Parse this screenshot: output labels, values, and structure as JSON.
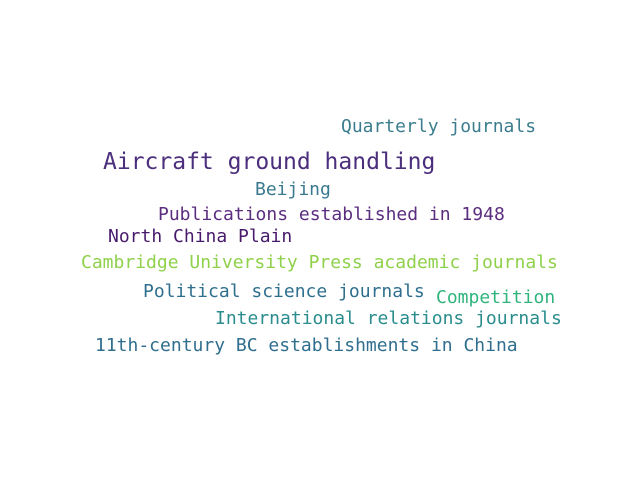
{
  "words": [
    {
      "text": "Quarterly journals",
      "color": "#3b7d8e"
    },
    {
      "text": "Aircraft ground handling",
      "color": "#4b2e7c"
    },
    {
      "text": "Beijing",
      "color": "#3a7a90"
    },
    {
      "text": "Publications established in 1948",
      "color": "#5a2d7f"
    },
    {
      "text": "North China Plain",
      "color": "#481a6c"
    },
    {
      "text": "Cambridge University Press academic journals",
      "color": "#8fd14a"
    },
    {
      "text": "Political science journals",
      "color": "#2f6f8e"
    },
    {
      "text": "Competition",
      "color": "#2fb47c"
    },
    {
      "text": "International relations journals",
      "color": "#2a8c8c"
    },
    {
      "text": "11th-century BC establishments in China",
      "color": "#2f6e8e"
    }
  ]
}
